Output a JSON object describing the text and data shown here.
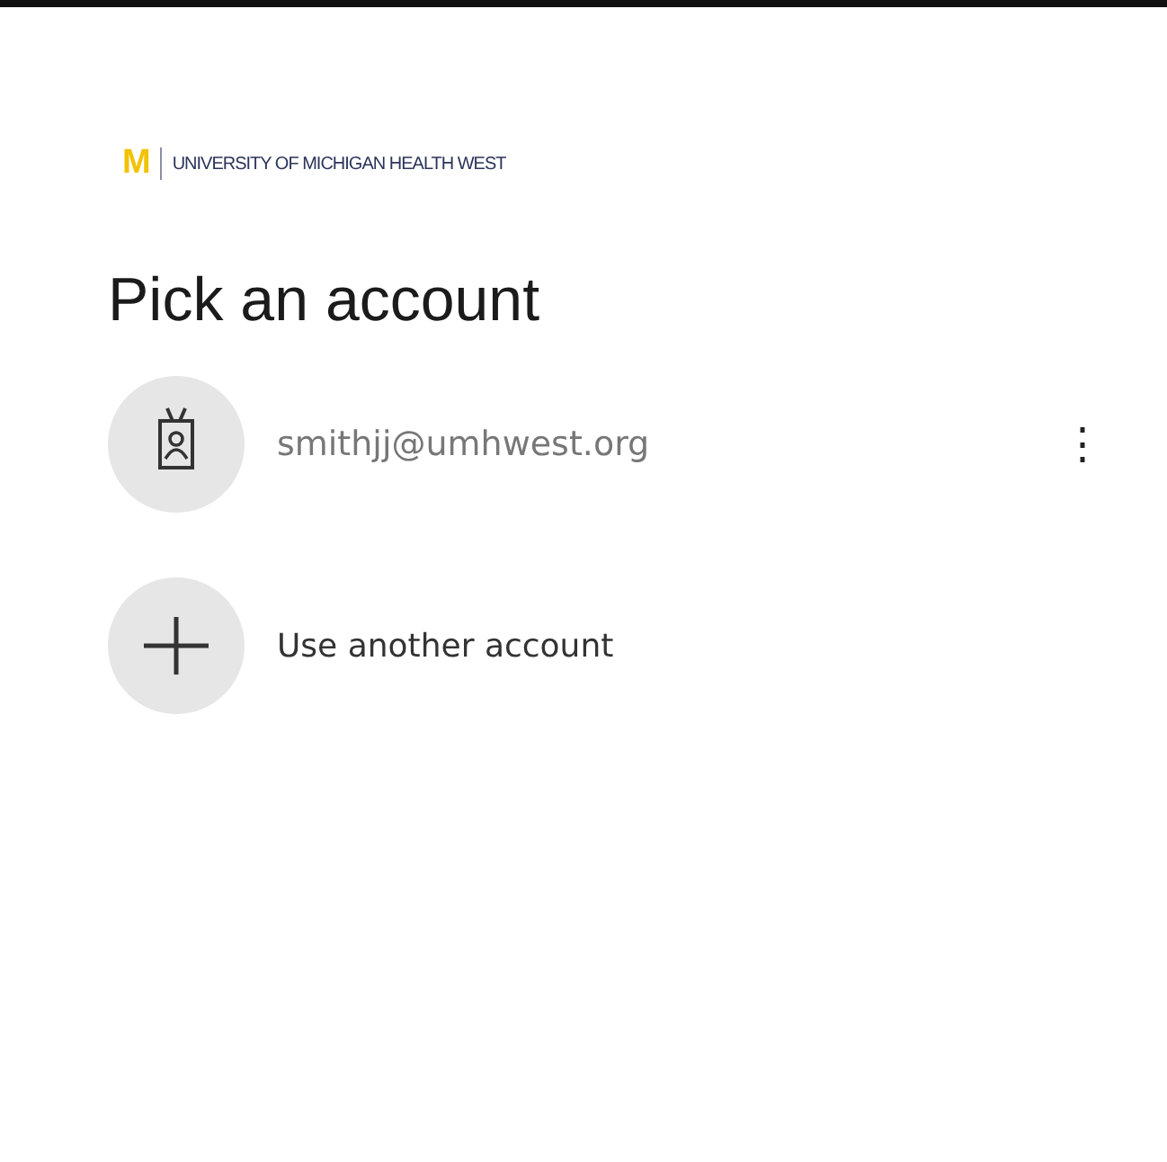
{
  "logo": {
    "mark": "M",
    "name": "UNIVERSITY OF MICHIGAN HEALTH WEST"
  },
  "title": "Pick an account",
  "accounts": [
    {
      "kind": "account",
      "label": "smithjj@umhwest.org",
      "menu": "⋮"
    },
    {
      "kind": "add",
      "label": "Use another account"
    }
  ]
}
